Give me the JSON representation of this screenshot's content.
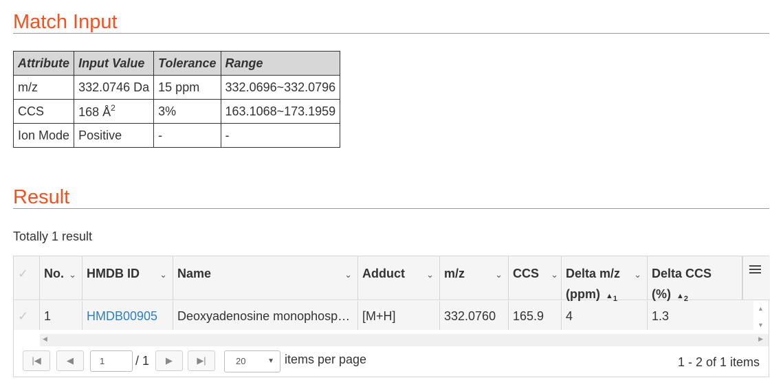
{
  "match_input": {
    "title": "Match Input",
    "headers": [
      "Attribute",
      "Input Value",
      "Tolerance",
      "Range"
    ],
    "rows": [
      {
        "attribute": "m/z",
        "value": "332.0746 Da",
        "tolerance": "15 ppm",
        "range": "332.0696~332.0796"
      },
      {
        "attribute": "CCS",
        "value": "168 Å",
        "value_sup": "2",
        "tolerance": "3%",
        "range": "163.1068~173.1959"
      },
      {
        "attribute": "Ion Mode",
        "value": "Positive",
        "tolerance": "-",
        "range": "-"
      }
    ]
  },
  "result": {
    "title": "Result",
    "summary": "Totally 1 result",
    "columns": [
      {
        "label": "No."
      },
      {
        "label": "HMDB ID"
      },
      {
        "label": "Name"
      },
      {
        "label": "Adduct"
      },
      {
        "label": "m/z"
      },
      {
        "label": "CCS"
      },
      {
        "label": "Delta m/z",
        "label2": "(ppm)",
        "sort_order": "1"
      },
      {
        "label": "Delta CCS",
        "label2": "(%)",
        "sort_order": "2"
      }
    ],
    "rows": [
      {
        "no": "1",
        "hmdb_id": "HMDB00905",
        "name": "Deoxyadenosine monophosphate",
        "adduct": "[M+H]",
        "mz": "332.0760",
        "ccs": "165.9",
        "delta_mz": "4",
        "delta_ccs": "1.3"
      }
    ],
    "pager": {
      "page": "1",
      "total_pages": "/ 1",
      "page_size": "20",
      "items_per_page_label": "items per page",
      "info": "1 - 2 of 1 items"
    }
  },
  "colors": {
    "accent": "#f4511e",
    "link": "#2f7fbf"
  }
}
